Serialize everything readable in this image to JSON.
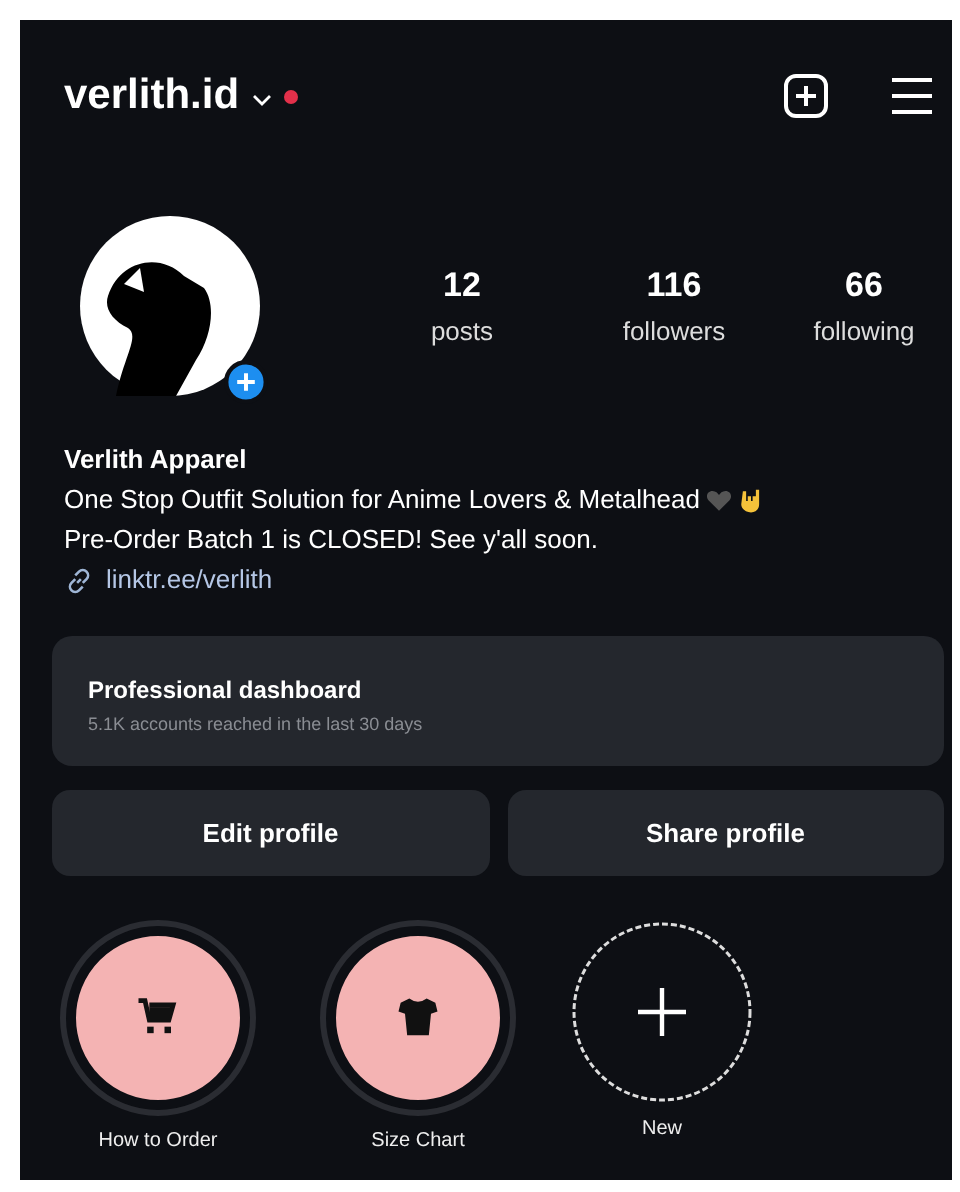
{
  "header": {
    "username": "verlith.id"
  },
  "profile": {
    "stats": [
      {
        "value": "12",
        "label": "posts"
      },
      {
        "value": "116",
        "label": "followers"
      },
      {
        "value": "66",
        "label": "following"
      }
    ],
    "name": "Verlith Apparel",
    "bio": [
      "One Stop Outfit Solution for Anime Lovers & Metalhead",
      "Pre-Order Batch 1 is CLOSED! See y'all soon."
    ],
    "link": "linktr.ee/verlith"
  },
  "dashboard": {
    "title": "Professional dashboard",
    "subtitle": "5.1K accounts reached in the last 30 days"
  },
  "buttons": [
    "Edit profile",
    "Share profile"
  ],
  "highlights": [
    {
      "label": "How to Order",
      "kind": "cart"
    },
    {
      "label": "Size Chart",
      "kind": "shirt"
    },
    {
      "label": "New",
      "kind": "new"
    }
  ]
}
